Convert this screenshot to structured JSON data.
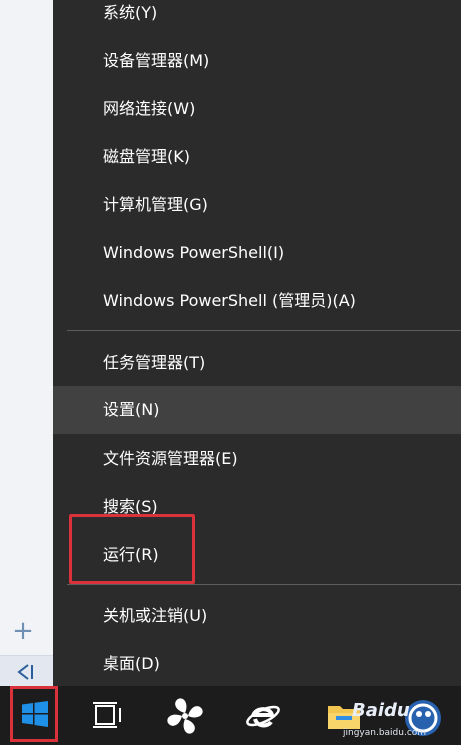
{
  "menu": {
    "items": [
      {
        "label": "系统(Y)"
      },
      {
        "label": "设备管理器(M)"
      },
      {
        "label": "网络连接(W)"
      },
      {
        "label": "磁盘管理(K)"
      },
      {
        "label": "计算机管理(G)"
      },
      {
        "label": "Windows PowerShell(I)"
      },
      {
        "label": "Windows PowerShell (管理员)(A)"
      },
      {
        "label": "任务管理器(T)"
      },
      {
        "label": "设置(N)"
      },
      {
        "label": "文件资源管理器(E)"
      },
      {
        "label": "搜索(S)"
      },
      {
        "label": "运行(R)"
      },
      {
        "label": "关机或注销(U)"
      },
      {
        "label": "桌面(D)"
      }
    ],
    "hovered_item": "设置(N)",
    "highlight_color": "#d9323a"
  },
  "left_panel": {
    "plus_glyph": "+"
  },
  "taskbar": {
    "icons": [
      "windows-start-icon",
      "task-view-icon",
      "fan-app-icon",
      "internet-explorer-icon",
      "file-explorer-icon"
    ],
    "accent_color": "#1e90e8"
  },
  "watermark": {
    "text": "Baidu",
    "sub": "jingyan.baidu.com"
  }
}
